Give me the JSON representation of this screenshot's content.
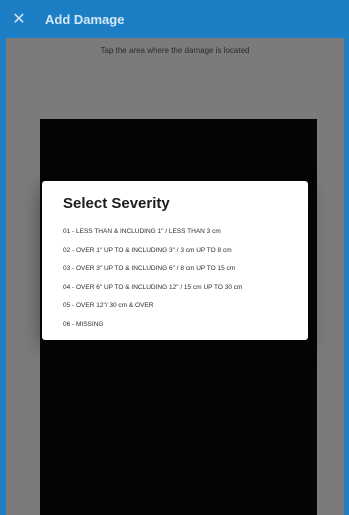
{
  "header": {
    "close_icon": "✕",
    "title": "Add Damage"
  },
  "main": {
    "instruction": "Tap the area where the damage is located"
  },
  "dialog": {
    "title": "Select Severity",
    "options": [
      "01 - LESS THAN & INCLUDING 1\" / LESS THAN 3 cm",
      "02 - OVER 1\" UP TO & INCLUDING 3\" / 3 cm UP TO 8 cm",
      "03 - OVER 3\" UP TO & INCLUDING 6\" / 8 cm UP TO 15 cm",
      "04 - OVER 6\" UP TO & INCLUDING 12\" / 15 cm UP TO 30 cm",
      "05 - OVER 12\"/ 30 cm & OVER",
      "06 - MISSING"
    ]
  },
  "colors": {
    "appbar": "#1c7fc6",
    "overlay_background": "#7b7b7b",
    "dialog_background": "#ffffff"
  }
}
